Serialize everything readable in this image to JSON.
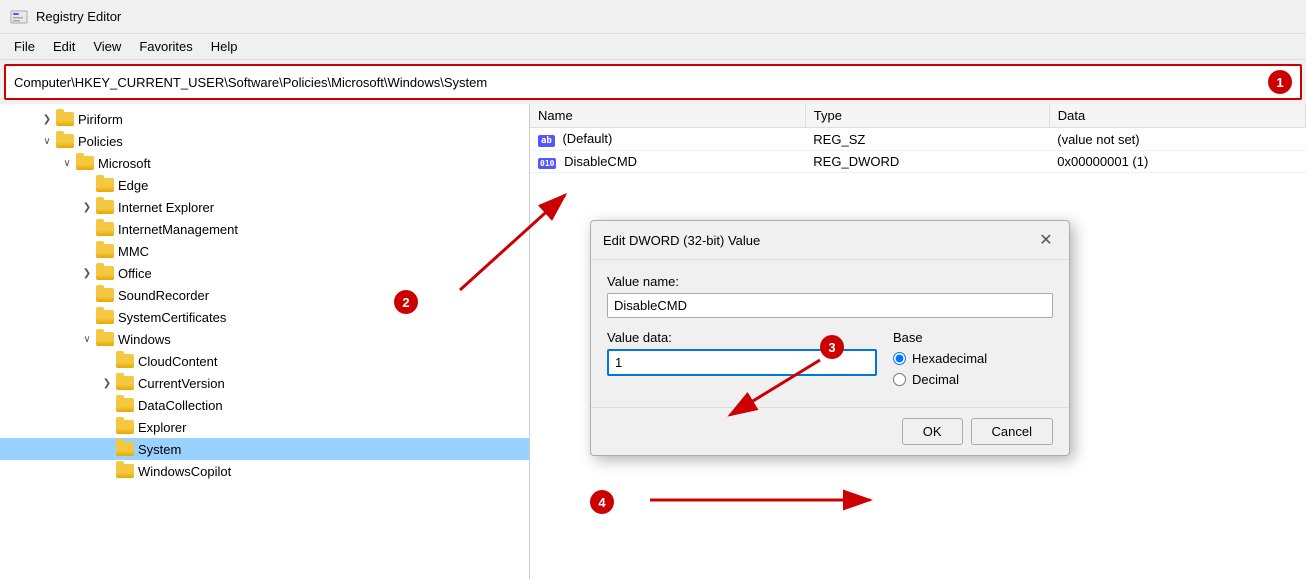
{
  "titlebar": {
    "icon": "regedit",
    "title": "Registry Editor"
  },
  "menubar": {
    "items": [
      "File",
      "Edit",
      "View",
      "Favorites",
      "Help"
    ]
  },
  "addressbar": {
    "path": "Computer\\HKEY_CURRENT_USER\\Software\\Policies\\Microsoft\\Windows\\System",
    "badge": "1"
  },
  "tree": {
    "items": [
      {
        "label": "Piriform",
        "indent": 2,
        "expanded": false,
        "has_children": true
      },
      {
        "label": "Policies",
        "indent": 2,
        "expanded": true,
        "has_children": true
      },
      {
        "label": "Microsoft",
        "indent": 3,
        "expanded": true,
        "has_children": true
      },
      {
        "label": "Edge",
        "indent": 4,
        "expanded": false,
        "has_children": false
      },
      {
        "label": "Internet Explorer",
        "indent": 4,
        "expanded": false,
        "has_children": true
      },
      {
        "label": "InternetManagement",
        "indent": 4,
        "expanded": false,
        "has_children": false
      },
      {
        "label": "MMC",
        "indent": 4,
        "expanded": false,
        "has_children": false
      },
      {
        "label": "Office",
        "indent": 4,
        "expanded": false,
        "has_children": true
      },
      {
        "label": "SoundRecorder",
        "indent": 4,
        "expanded": false,
        "has_children": false
      },
      {
        "label": "SystemCertificates",
        "indent": 4,
        "expanded": false,
        "has_children": false
      },
      {
        "label": "Windows",
        "indent": 4,
        "expanded": true,
        "has_children": true
      },
      {
        "label": "CloudContent",
        "indent": 5,
        "expanded": false,
        "has_children": false
      },
      {
        "label": "CurrentVersion",
        "indent": 5,
        "expanded": false,
        "has_children": true
      },
      {
        "label": "DataCollection",
        "indent": 5,
        "expanded": false,
        "has_children": false
      },
      {
        "label": "Explorer",
        "indent": 5,
        "expanded": false,
        "has_children": false
      },
      {
        "label": "System",
        "indent": 5,
        "expanded": false,
        "has_children": false,
        "selected": true
      },
      {
        "label": "WindowsCopilot",
        "indent": 5,
        "expanded": false,
        "has_children": false
      }
    ]
  },
  "registry_table": {
    "columns": [
      "Name",
      "Type",
      "Data"
    ],
    "rows": [
      {
        "icon": "ab",
        "name": "(Default)",
        "type": "REG_SZ",
        "data": "(value not set)"
      },
      {
        "icon": "dword",
        "name": "DisableCMD",
        "type": "REG_DWORD",
        "data": "0x00000001 (1)"
      }
    ]
  },
  "modal": {
    "title": "Edit DWORD (32-bit) Value",
    "value_name_label": "Value name:",
    "value_name": "DisableCMD",
    "value_data_label": "Value data:",
    "value_data": "1",
    "base_label": "Base",
    "base_options": [
      "Hexadecimal",
      "Decimal"
    ],
    "base_selected": "Hexadecimal",
    "btn_ok": "OK",
    "btn_cancel": "Cancel"
  },
  "badges": {
    "b1": "1",
    "b2": "2",
    "b3": "3",
    "b4": "4"
  },
  "colors": {
    "red": "#cc0000",
    "blue": "#0078d4",
    "folder_yellow": "#f5c842"
  }
}
